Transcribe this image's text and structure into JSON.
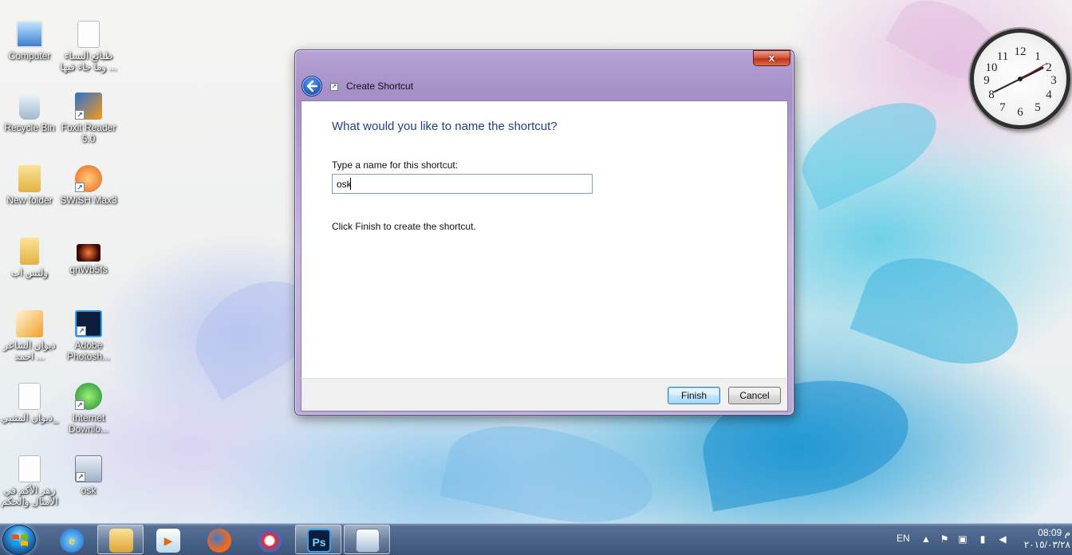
{
  "desktop": {
    "icons": [
      {
        "label": "Computer",
        "icon": "computer-icon"
      },
      {
        "label": "طبائع النساء وما جاء فيها ...",
        "icon": "document-icon"
      },
      {
        "label": "Recycle Bin",
        "icon": "recycle-bin-icon"
      },
      {
        "label": "Foxit Reader 5.0",
        "icon": "foxit-reader-icon"
      },
      {
        "label": "New folder",
        "icon": "folder-icon"
      },
      {
        "label": "SWiSH Max3",
        "icon": "swish-icon"
      },
      {
        "label": "ولتس اب",
        "icon": "folder-icon"
      },
      {
        "label": "qnWb5fs",
        "icon": "image-icon"
      },
      {
        "label": "ديوان الشاعر احمد ...",
        "icon": "pdf-icon"
      },
      {
        "label": "Adobe Photosh...",
        "icon": "photoshop-icon"
      },
      {
        "label": "ديوان المتنبي_",
        "icon": "document-icon"
      },
      {
        "label": "Internet Downlo...",
        "icon": "internet-download-manager-icon"
      },
      {
        "label": "زهر الأكم في الأمثال والحكم",
        "icon": "document-icon"
      },
      {
        "label": "osk",
        "icon": "keyboard-icon"
      }
    ]
  },
  "dialog": {
    "title": "Create Shortcut",
    "close_label": "x",
    "heading": "What would you like to name the shortcut?",
    "field_label": "Type a name for this shortcut:",
    "name_value": "osk",
    "hint": "Click Finish to create the shortcut.",
    "finish_label": "Finish",
    "cancel_label": "Cancel"
  },
  "taskbar": {
    "pinned": [
      {
        "icon": "internet-explorer-icon"
      },
      {
        "icon": "windows-explorer-icon",
        "active": true
      },
      {
        "icon": "media-player-icon"
      },
      {
        "icon": "firefox-icon"
      },
      {
        "icon": "app-swirl-icon"
      },
      {
        "icon": "photoshop-icon",
        "active": true,
        "text": "Ps"
      },
      {
        "icon": "on-screen-keyboard-icon",
        "active": true
      }
    ],
    "tray": {
      "language": "EN",
      "time": "08:09 م",
      "date": "٢٠١٥/٠٣/٢٨"
    }
  },
  "clock": {
    "hour_labels": [
      "12",
      "1",
      "2",
      "3",
      "4",
      "5",
      "6",
      "7",
      "8",
      "9",
      "10",
      "11"
    ]
  },
  "colors": {
    "accent": "#1f3f8f",
    "taskbar": "#4a6389",
    "close": "#c1341b"
  }
}
